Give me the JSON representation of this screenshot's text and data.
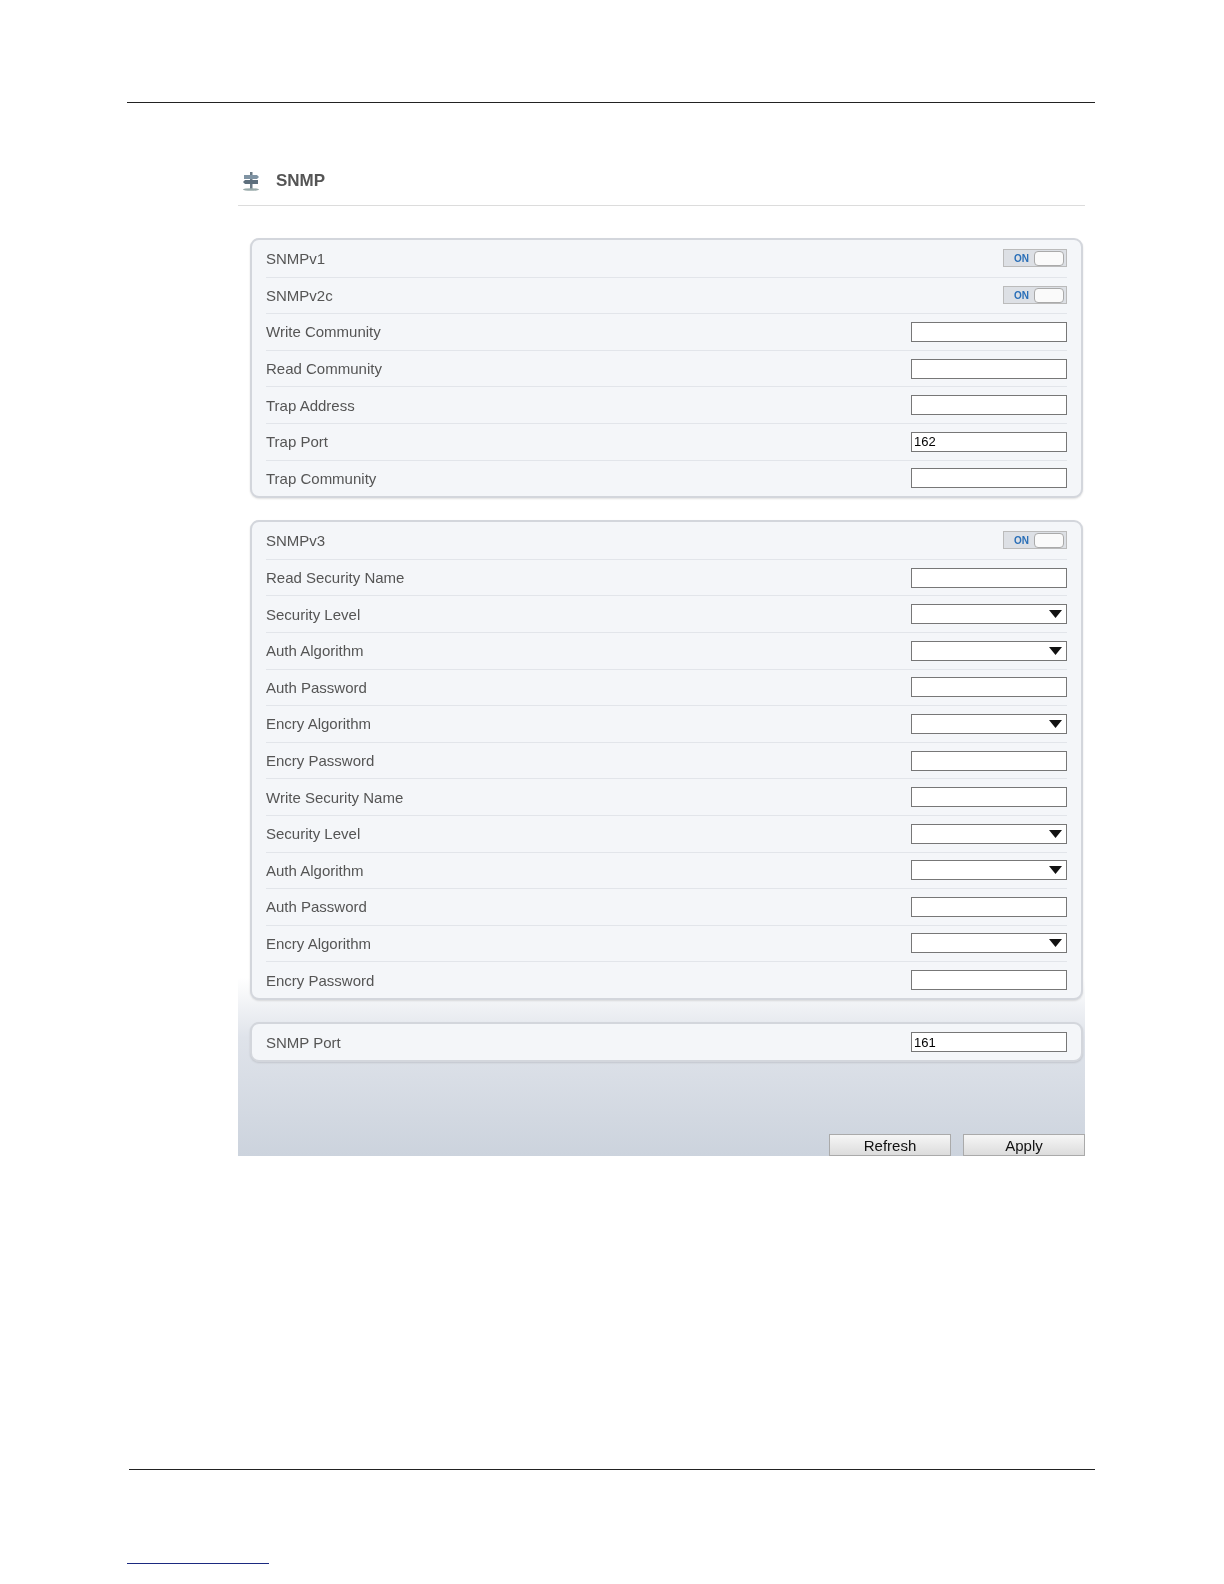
{
  "title": "SNMP",
  "panels": [
    {
      "rows": [
        {
          "kind": "toggle",
          "label": "SNMPv1",
          "state_text": "ON",
          "on": true
        },
        {
          "kind": "toggle",
          "label": "SNMPv2c",
          "state_text": "ON",
          "on": true
        },
        {
          "kind": "text",
          "label": "Write Community"
        },
        {
          "kind": "text",
          "label": "Read Community"
        },
        {
          "kind": "text",
          "label": "Trap Address"
        },
        {
          "kind": "text",
          "label": "Trap Port",
          "value": "162"
        },
        {
          "kind": "text",
          "label": "Trap Community"
        }
      ]
    },
    {
      "rows": [
        {
          "kind": "toggle",
          "label": "SNMPv3",
          "state_text": "ON",
          "on": true
        },
        {
          "kind": "text",
          "label": "Read Security Name"
        },
        {
          "kind": "select",
          "label": "Security Level"
        },
        {
          "kind": "select",
          "label": "Auth Algorithm"
        },
        {
          "kind": "text",
          "label": "Auth Password"
        },
        {
          "kind": "select",
          "label": "Encry Algorithm"
        },
        {
          "kind": "text",
          "label": "Encry Password"
        },
        {
          "kind": "text",
          "label": "Write Security Name"
        },
        {
          "kind": "select",
          "label": "Security Level"
        },
        {
          "kind": "select",
          "label": "Auth Algorithm"
        },
        {
          "kind": "text",
          "label": "Auth Password"
        },
        {
          "kind": "select",
          "label": "Encry Algorithm"
        },
        {
          "kind": "text",
          "label": "Encry Password"
        }
      ]
    },
    {
      "rows": [
        {
          "kind": "text",
          "label": "SNMP Port",
          "value": "161"
        }
      ]
    }
  ],
  "buttons": [
    "Refresh",
    "Apply"
  ]
}
